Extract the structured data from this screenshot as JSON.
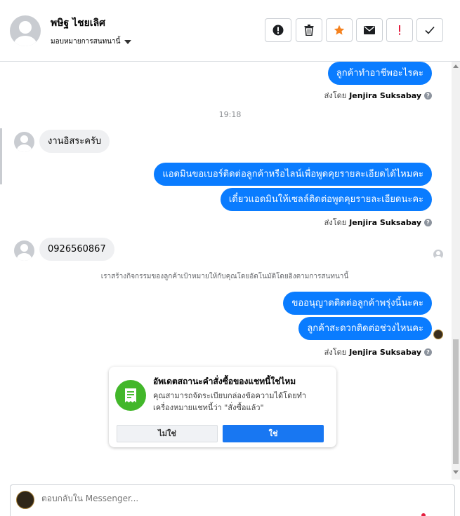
{
  "header": {
    "contact_name": "พษิฐ ไชยเลิศ",
    "assign_label": "มอบหมายการสนทนานี้",
    "toolbar": [
      {
        "name": "spam-button",
        "icon": "alert-circle-icon"
      },
      {
        "name": "delete-button",
        "icon": "trash-icon"
      },
      {
        "name": "star-button",
        "icon": "star-icon"
      },
      {
        "name": "mark-unread-button",
        "icon": "envelope-icon"
      },
      {
        "name": "follow-up-button",
        "icon": "exclamation-icon"
      },
      {
        "name": "done-button",
        "icon": "check-icon"
      }
    ]
  },
  "messages": {
    "m1": "ลูกค้าทำอาชีพอะไรคะ",
    "sent_by_prefix": "ส่งโดย",
    "agent_name": "Jenjira Suksabay",
    "time": "19:18",
    "m2": "งานอิสระครับ",
    "m3": "แอดมินขอเบอร์ติดต่อลูกค้าหรือไลน์เพื่อพูดคุยรายละเอียดได้ไหมคะ",
    "m4": "เดี๋ยวแอดมินให้เซลล์ติดต่อพูดคุยรายละเอียดนะคะ",
    "m5": "0926560867",
    "system_note": "เราสร้างกิจกรรมของลูกค้าเป้าหมายให้กับคุณโดยอัตโนมัติโดยอิงตามการสนทนานี้",
    "m6": "ขออนุญาตติดต่อลูกค้าพรุ่งนี้นะคะ",
    "m7": "ลูกค้าสะดวกติดต่อช่วงไหนคะ"
  },
  "card": {
    "title": "อัพเดตสถานะคำสั่งซื้อของแชทนี้ใช่ไหม",
    "description": "คุณสามารถจัดระเบียบกล่องข้อความได้โดยทำเครื่องหมายแชทนี้ว่า \"สั่งซื้อแล้ว\"",
    "no_label": "ไม่ใช่",
    "yes_label": "ใช่"
  },
  "composer": {
    "placeholder": "ตอบกลับใน Messenger..."
  },
  "colors": {
    "outgoing_bubble": "#0a7cff",
    "incoming_bubble": "#eff0f2",
    "primary_button": "#1877f2",
    "card_icon": "#42b72a",
    "star": "#f5821f",
    "follow_up": "#e41e3f"
  }
}
